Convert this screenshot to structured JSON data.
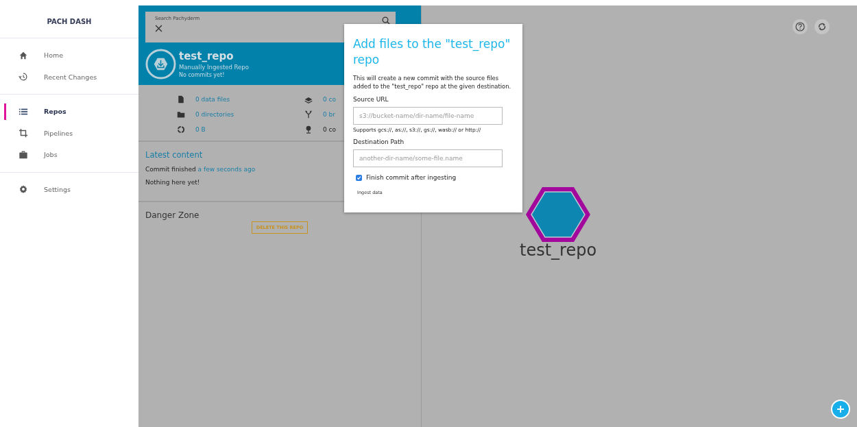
{
  "sidebar": {
    "title": "PACH DASH",
    "sections": [
      {
        "items": [
          {
            "label": "Home",
            "selected": false
          },
          {
            "label": "Recent Changes",
            "selected": false
          }
        ]
      },
      {
        "items": [
          {
            "label": "Repos",
            "selected": true
          },
          {
            "label": "Pipelines",
            "selected": false
          },
          {
            "label": "Jobs",
            "selected": false
          }
        ]
      },
      {
        "items": [
          {
            "label": "Settings",
            "selected": false
          }
        ]
      }
    ]
  },
  "search": {
    "label": "Search Pachyderm"
  },
  "repo": {
    "name": "test_repo",
    "subtitle": "Manually Ingested Repo",
    "status": "No commits yet!"
  },
  "stats": [
    {
      "text": "0 data files",
      "link": true
    },
    {
      "text": "0 co",
      "link": true
    },
    {
      "text": "0 directories",
      "link": true
    },
    {
      "text": "0 br",
      "link": true
    },
    {
      "text": "0 B",
      "link": true
    },
    {
      "text": "0 co",
      "link": false
    }
  ],
  "latest": {
    "title": "Latest content",
    "commit_text": "Commit finished",
    "commit_time": "a few seconds ago",
    "empty": "Nothing here yet!"
  },
  "danger": {
    "title": "Danger Zone",
    "button": "DELETE THIS REPO"
  },
  "modal": {
    "title": "Add files to the \"test_repo\" repo",
    "description": "This will create a new commit with the source files added to the \"test_repo\" repo at the given destination.",
    "fields": [
      {
        "label": "Source URL",
        "placeholder": "s3://bucket-name/dir-name/file-name",
        "hint": "Supports gcs://, as://, s3://, gs://, wasb:// or http://"
      },
      {
        "label": "Destination Path",
        "placeholder": "another-dir-name/some-file.name"
      }
    ],
    "checkbox": {
      "label": "Finish commit after ingesting",
      "checked": true
    },
    "submit": "Ingest data"
  },
  "canvas": {
    "node_label": "test_repo"
  }
}
